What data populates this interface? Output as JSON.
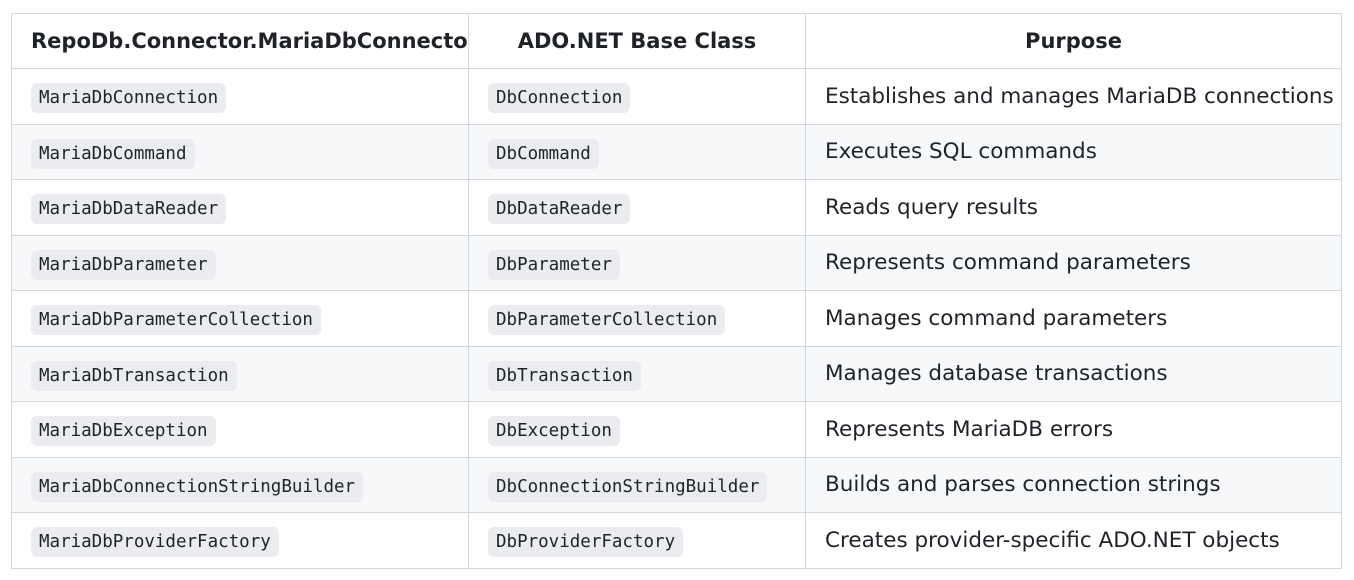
{
  "table": {
    "headers": [
      "RepoDb.Connector.MariaDbConnector",
      "ADO.NET Base Class",
      "Purpose"
    ],
    "rows": [
      {
        "connector": "MariaDbConnection",
        "base": "DbConnection",
        "purpose": "Establishes and manages MariaDB connections"
      },
      {
        "connector": "MariaDbCommand",
        "base": "DbCommand",
        "purpose": "Executes SQL commands"
      },
      {
        "connector": "MariaDbDataReader",
        "base": "DbDataReader",
        "purpose": "Reads query results"
      },
      {
        "connector": "MariaDbParameter",
        "base": "DbParameter",
        "purpose": "Represents command parameters"
      },
      {
        "connector": "MariaDbParameterCollection",
        "base": "DbParameterCollection",
        "purpose": "Manages command parameters"
      },
      {
        "connector": "MariaDbTransaction",
        "base": "DbTransaction",
        "purpose": "Manages database transactions"
      },
      {
        "connector": "MariaDbException",
        "base": "DbException",
        "purpose": "Represents MariaDB errors"
      },
      {
        "connector": "MariaDbConnectionStringBuilder",
        "base": "DbConnectionStringBuilder",
        "purpose": "Builds and parses connection strings"
      },
      {
        "connector": "MariaDbProviderFactory",
        "base": "DbProviderFactory",
        "purpose": "Creates provider-specific ADO.NET objects"
      }
    ]
  }
}
